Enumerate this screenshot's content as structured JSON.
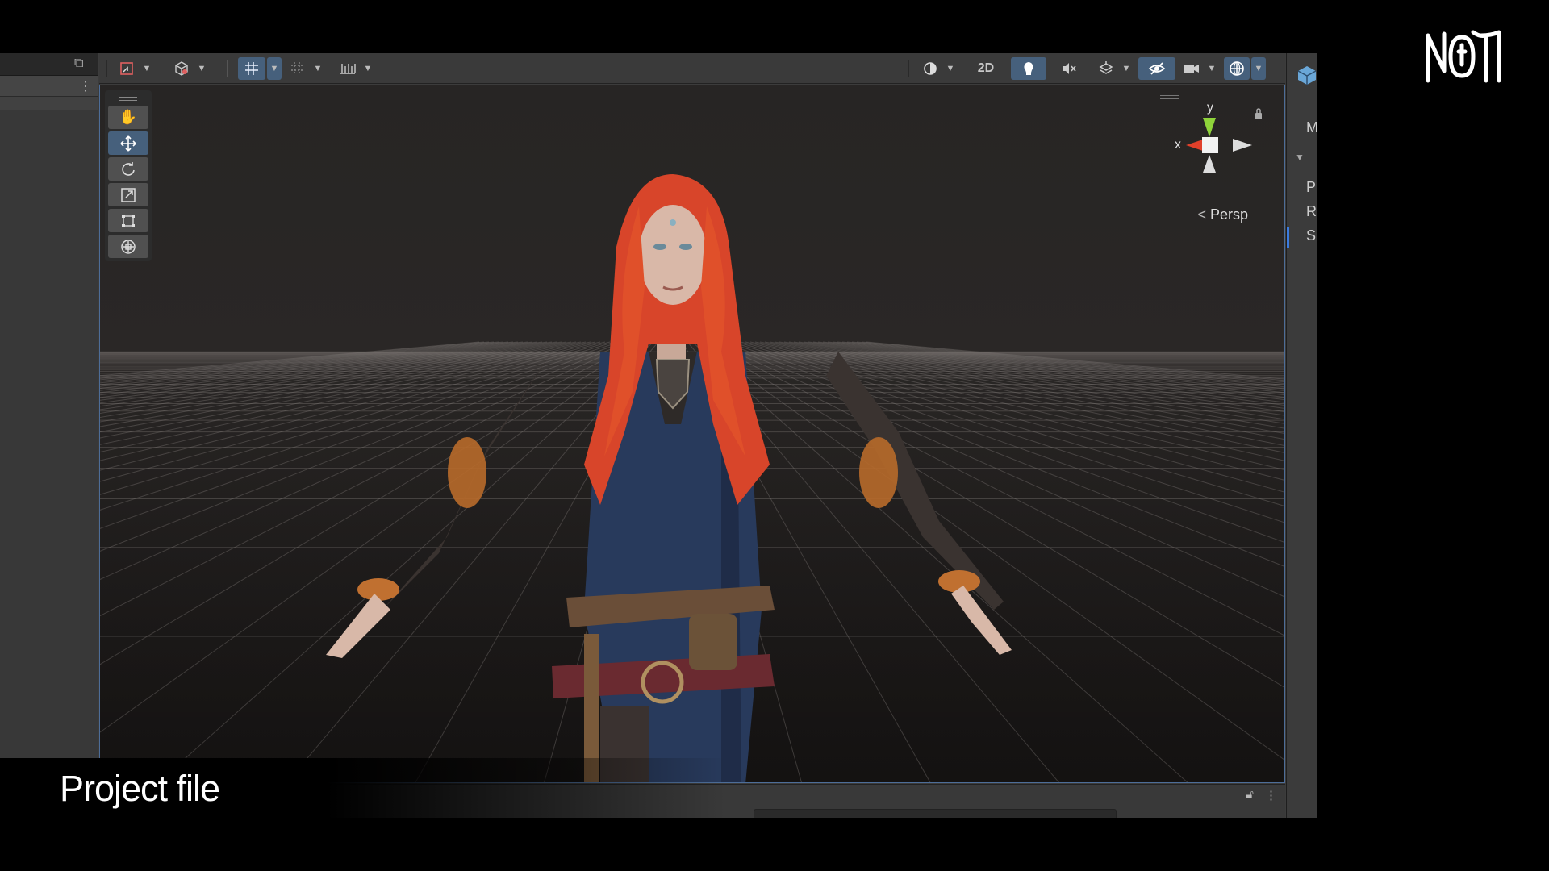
{
  "brand": {
    "logo_text": "NOTT"
  },
  "caption": {
    "text": "Project file"
  },
  "scene_toolbar": {
    "view_mode_label": "2D",
    "left_icons": [
      "gizmo-tool-icon",
      "shaded-cube-icon",
      "grid-snap-icon",
      "increment-snap-icon",
      "ruler-icon"
    ],
    "right_icons": [
      "draw-mode-icon",
      "lighting-icon",
      "audio-icon",
      "effects-icon",
      "hidden-objects-icon",
      "camera-icon",
      "gizmos-icon"
    ]
  },
  "transform_tools": [
    "hand-tool",
    "move-tool",
    "rotate-tool",
    "scale-tool",
    "rect-tool",
    "transform-tool"
  ],
  "active_tool": "move-tool",
  "gizmo": {
    "y_label": "y",
    "x_label": "x",
    "projection_label": "Persp"
  },
  "inspector": {
    "letters": [
      "M",
      "P",
      "R",
      "S"
    ]
  },
  "colors": {
    "accent": "#46607c",
    "selection_border": "#4d6d98",
    "gizmo_x": "#e0402a",
    "gizmo_y": "#8fd43a",
    "hair": "#e0502a"
  }
}
